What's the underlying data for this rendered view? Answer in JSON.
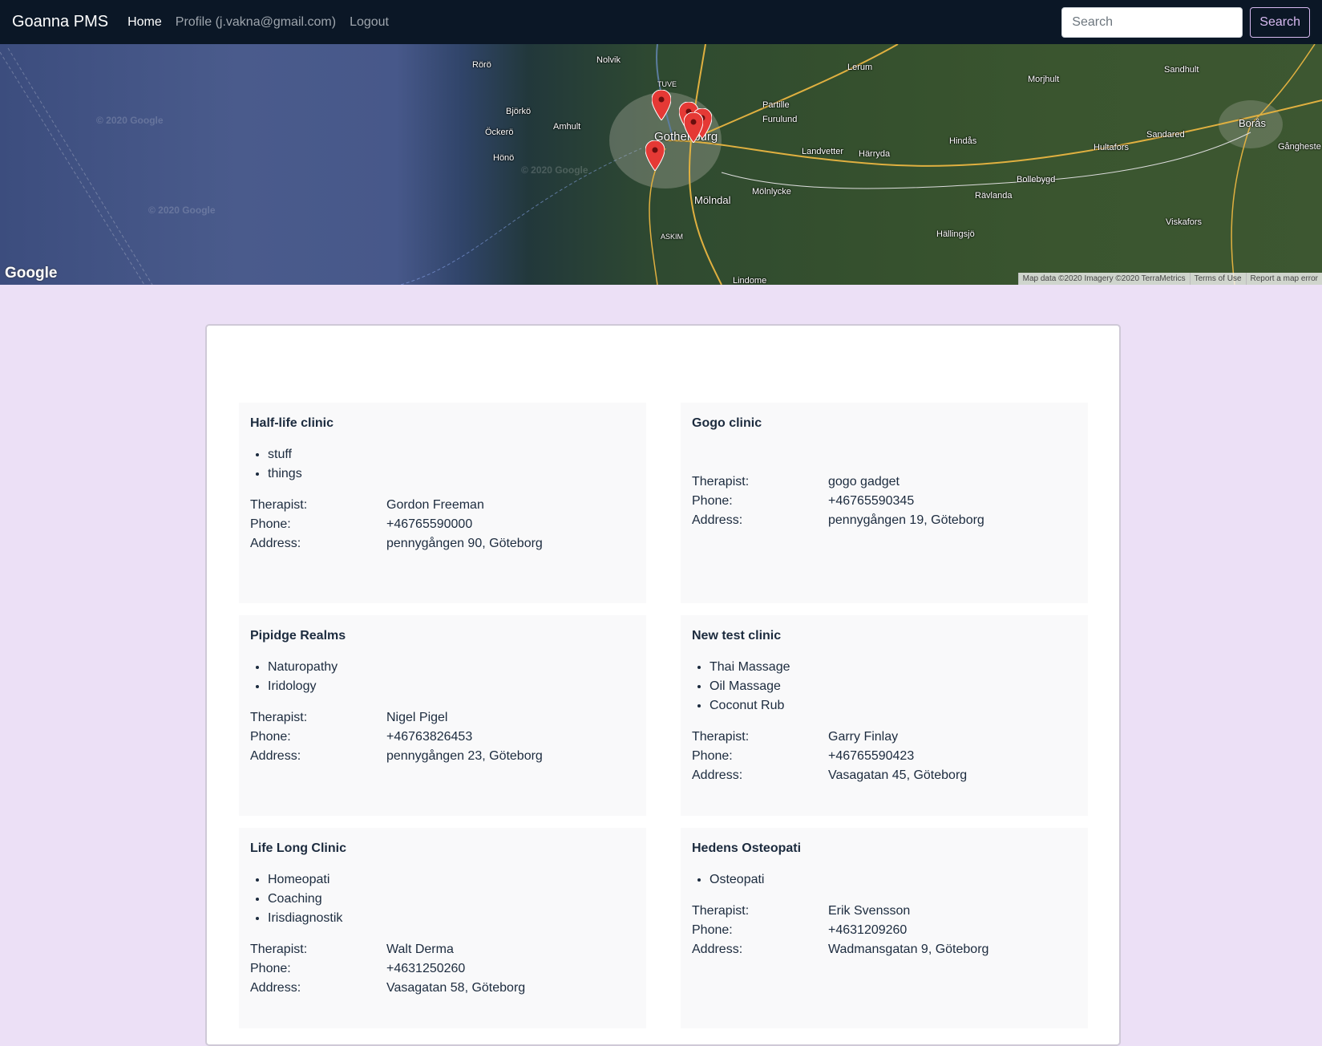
{
  "navbar": {
    "brand": "Goanna PMS",
    "links": [
      {
        "label": "Home",
        "active": true
      },
      {
        "label": "Profile (j.vakna@gmail.com)",
        "active": false
      },
      {
        "label": "Logout",
        "active": false
      }
    ],
    "search_placeholder": "Search",
    "search_button": "Search"
  },
  "map": {
    "labels": {
      "roro": "Rörö",
      "nolvik": "Nolvik",
      "tuve": "TUVE",
      "lerum": "Lerum",
      "bjorko": "Björkö",
      "ockero": "Öckerö",
      "amhult": "Amhult",
      "hono": "Hönö",
      "gothenburg": "Gothenburg",
      "partille": "Partille",
      "furulund": "Furulund",
      "molndal": "Mölndal",
      "molnlycke": "Mölnlycke",
      "landvetter": "Landvetter",
      "harryda": "Härryda",
      "hindas": "Hindås",
      "askim": "ASKIM",
      "lindome": "Lindome",
      "hallingsjo": "Hällingsjö",
      "ravlanda": "Rävlanda",
      "bollebygd": "Bollebygd",
      "hultafors": "Hultafors",
      "sandared": "Sandared",
      "boras": "Borås",
      "sandhult": "Sandhult",
      "morjhult": "Morjhult",
      "viskafors": "Viskafors",
      "gangheste": "Gångheste"
    },
    "watermark": "© 2020 Google",
    "logo": "Google",
    "footer": {
      "data": "Map data ©2020 Imagery ©2020 TerraMetrics",
      "terms": "Terms of Use",
      "report": "Report a map error"
    }
  },
  "clinics": [
    {
      "name": "Half-life clinic",
      "services": [
        "stuff",
        "things"
      ],
      "therapist": "Gordon Freeman",
      "phone": "+46765590000",
      "address": "pennygången 90, Göteborg"
    },
    {
      "name": "Gogo clinic",
      "services": [],
      "therapist": "gogo gadget",
      "phone": "+46765590345",
      "address": "pennygången 19, Göteborg"
    },
    {
      "name": "Pipidge Realms",
      "services": [
        "Naturopathy",
        "Iridology"
      ],
      "therapist": "Nigel Pigel",
      "phone": "+46763826453",
      "address": "pennygången 23, Göteborg"
    },
    {
      "name": "New test clinic",
      "services": [
        "Thai Massage",
        "Oil Massage",
        "Coconut Rub"
      ],
      "therapist": "Garry Finlay",
      "phone": "+46765590423",
      "address": "Vasagatan 45, Göteborg"
    },
    {
      "name": "Life Long Clinic",
      "services": [
        "Homeopati",
        "Coaching",
        "Irisdiagnostik"
      ],
      "therapist": "Walt Derma",
      "phone": "+4631250260",
      "address": "Vasagatan 58, Göteborg"
    },
    {
      "name": "Hedens Osteopati",
      "services": [
        "Osteopati"
      ],
      "therapist": "Erik Svensson",
      "phone": "+4631209260",
      "address": "Wadmansgatan 9, Göteborg"
    }
  ],
  "labels": {
    "therapist": "Therapist:",
    "phone": "Phone:",
    "address": "Address:"
  }
}
